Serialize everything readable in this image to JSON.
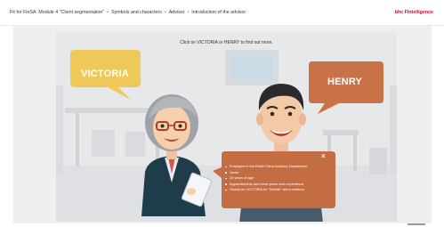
{
  "header": {
    "breadcrumb": [
      "Fit for FinSA: Module 4 \"Client segmentation\"",
      "Symbols and characters",
      "Advisor",
      "Introduction of the advisor"
    ],
    "separator": "•",
    "brand_prefix": "bhc",
    "brand_name": "Fintelligence"
  },
  "stage": {
    "instruction": "Click on VICTORIA or HENRY to find out more.",
    "characters": [
      {
        "name": "VICTORIA",
        "bubble_color": "#efc85a"
      },
      {
        "name": "HENRY",
        "bubble_color": "#c97248"
      }
    ],
    "info_panel": {
      "close": "×",
      "items": [
        "Employee in the Retail Client Advisory Department",
        "Junior",
        "23 years of age",
        "Apprenticeship and three years work experience",
        "Stands for VICTORIA for \"Wealth\" client relations"
      ],
      "background": "#c46d43"
    }
  },
  "colors": {
    "brand_red": "#c8102e",
    "brand_dark": "#333333"
  }
}
